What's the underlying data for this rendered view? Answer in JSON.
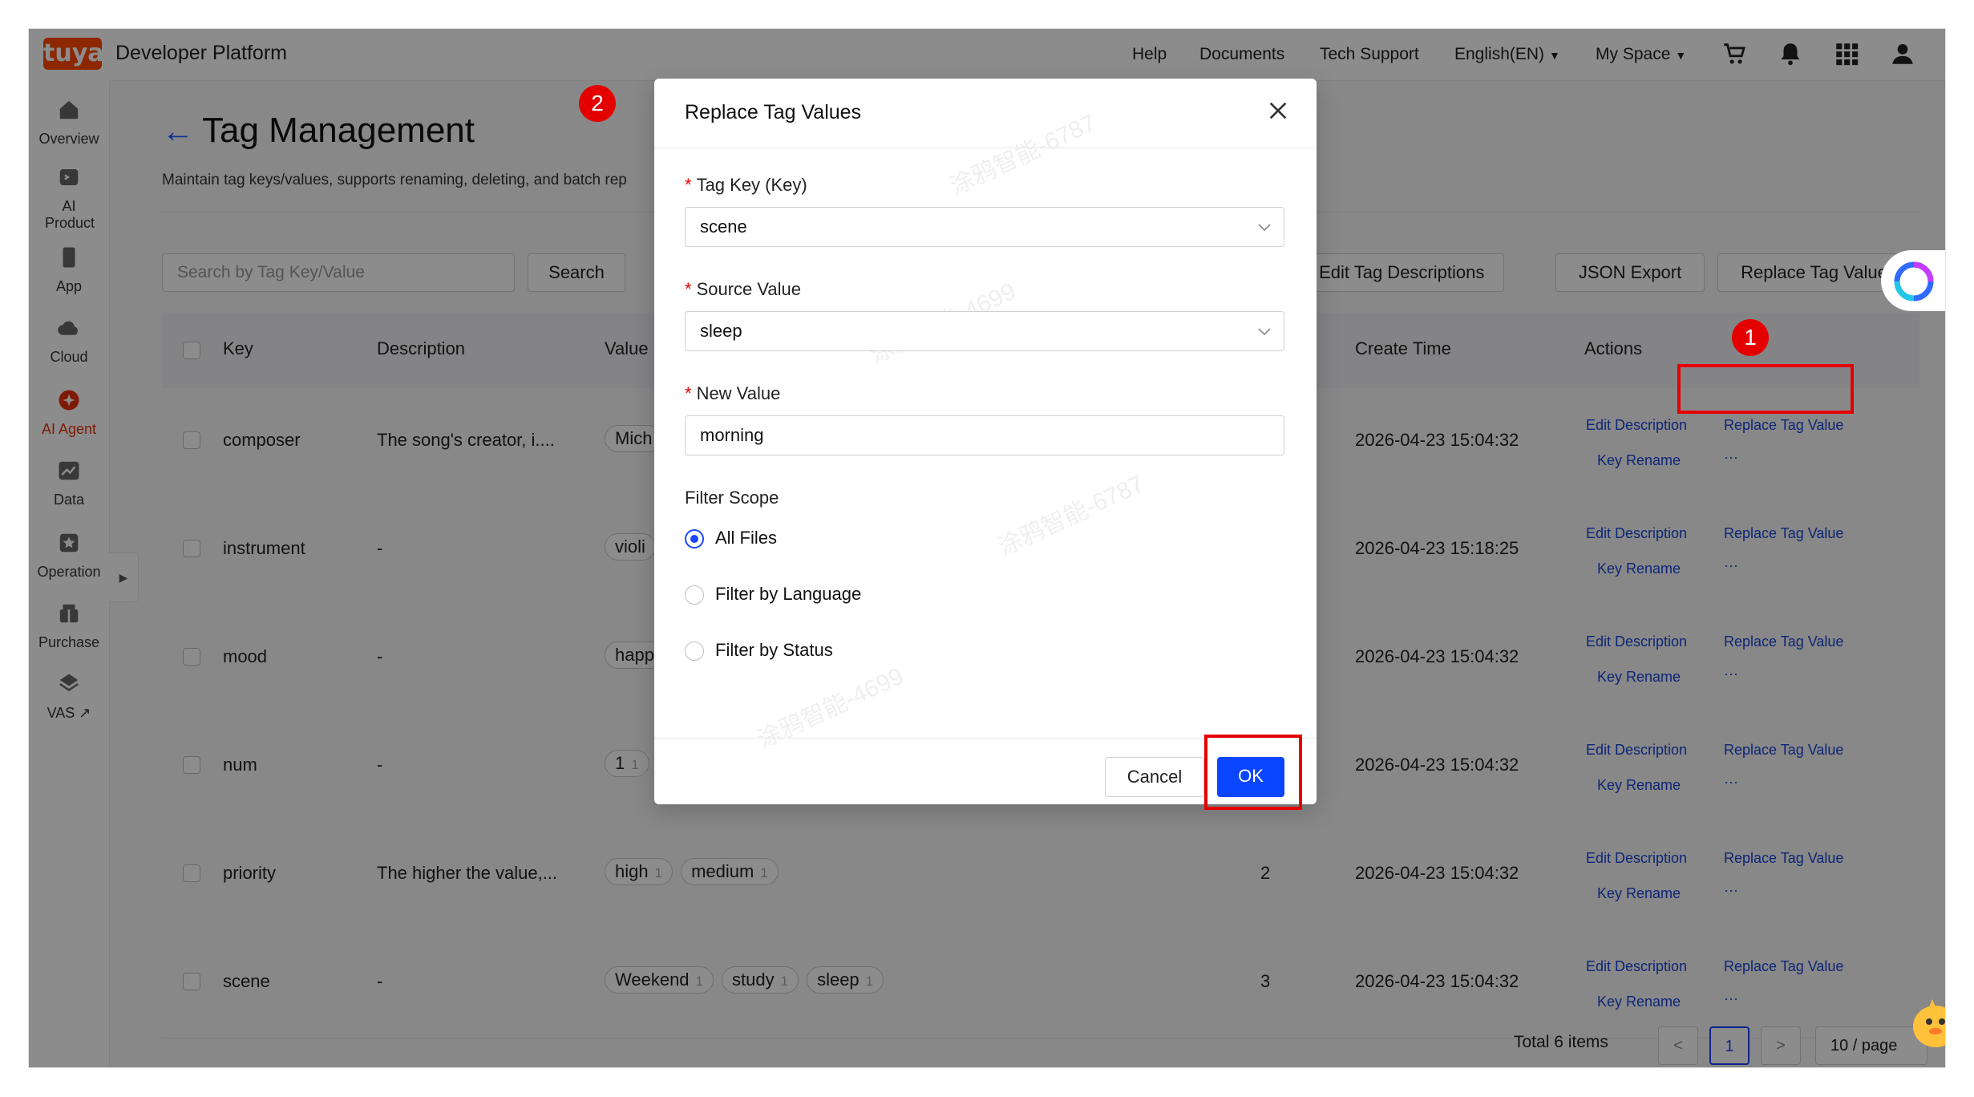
{
  "topbar": {
    "logo": "tuya",
    "brand": "Developer Platform",
    "nav": [
      "Help",
      "Documents",
      "Tech Support",
      "English(EN)",
      "My Space"
    ],
    "icons": [
      "cart-icon",
      "bell-icon",
      "grid-icon",
      "user-icon"
    ]
  },
  "sidebar": {
    "items": [
      {
        "label": "Overview",
        "icon": "home-icon"
      },
      {
        "label": "AI Product",
        "icon": "ai-product-icon"
      },
      {
        "label": "App",
        "icon": "app-icon"
      },
      {
        "label": "Cloud",
        "icon": "cloud-icon"
      },
      {
        "label": "AI Agent",
        "icon": "ai-agent-icon",
        "active": true
      },
      {
        "label": "Data",
        "icon": "data-icon"
      },
      {
        "label": "Operation",
        "icon": "operation-icon"
      },
      {
        "label": "Purchase",
        "icon": "purchase-icon"
      },
      {
        "label": "VAS",
        "icon": "vas-icon",
        "external": "↗"
      }
    ]
  },
  "page": {
    "title": "Tag Management",
    "subtitle": "Maintain tag keys/values, supports renaming, deleting, and batch rep"
  },
  "toolbar": {
    "search_placeholder": "Search by Tag Key/Value",
    "search_label": "Search",
    "batch_edit_label": "tch Edit Tag Descriptions",
    "json_export_label": "JSON Export",
    "replace_values_label": "Replace Tag Values"
  },
  "table": {
    "columns": [
      "Key",
      "Description",
      "Value",
      "Create Time",
      "Actions"
    ],
    "rows": [
      {
        "key": "composer",
        "description": "The song's creator, i....",
        "values": [
          {
            "text": "Mich",
            "count": ""
          }
        ],
        "count": "",
        "created": "2026-04-23 15:04:32"
      },
      {
        "key": "instrument",
        "description": "-",
        "values": [
          {
            "text": "violi",
            "count": ""
          }
        ],
        "count": "",
        "created": "2026-04-23 15:18:25"
      },
      {
        "key": "mood",
        "description": "-",
        "values": [
          {
            "text": "happ",
            "count": ""
          }
        ],
        "count": "",
        "created": "2026-04-23 15:04:32"
      },
      {
        "key": "num",
        "description": "-",
        "values": [
          {
            "text": "1",
            "count": "1"
          }
        ],
        "count": "",
        "created": "2026-04-23 15:04:32"
      },
      {
        "key": "priority",
        "description": "The higher the value,...",
        "values": [
          {
            "text": "high",
            "count": "1"
          },
          {
            "text": "medium",
            "count": "1"
          }
        ],
        "count": "2",
        "created": "2026-04-23 15:04:32"
      },
      {
        "key": "scene",
        "description": "-",
        "values": [
          {
            "text": "Weekend",
            "count": "1"
          },
          {
            "text": "study",
            "count": "1"
          },
          {
            "text": "sleep",
            "count": "1"
          }
        ],
        "count": "3",
        "created": "2026-04-23 15:04:32"
      }
    ],
    "actions": {
      "edit": "Edit Description",
      "replace": "Replace Tag Value",
      "rename": "Key Rename",
      "more": "···"
    }
  },
  "pagination": {
    "total": "Total 6 items",
    "prev": "<",
    "current": "1",
    "next": ">",
    "page_size": "10 / page"
  },
  "modal": {
    "title": "Replace Tag Values",
    "tag_key_label": "Tag Key (Key)",
    "tag_key_value": "scene",
    "source_label": "Source Value",
    "source_value": "sleep",
    "new_label": "New Value",
    "new_value": "morning",
    "scope_label": "Filter Scope",
    "scope_options": [
      "All Files",
      "Filter by Language",
      "Filter by Status"
    ],
    "scope_selected": "All Files",
    "cancel_label": "Cancel",
    "ok_label": "OK"
  },
  "annotations": {
    "badge1": "1",
    "badge2": "2"
  },
  "colors": {
    "brand": "#ff4800",
    "primary": "#1a45ff",
    "annotation": "#e50000",
    "link": "#1a45d6"
  }
}
